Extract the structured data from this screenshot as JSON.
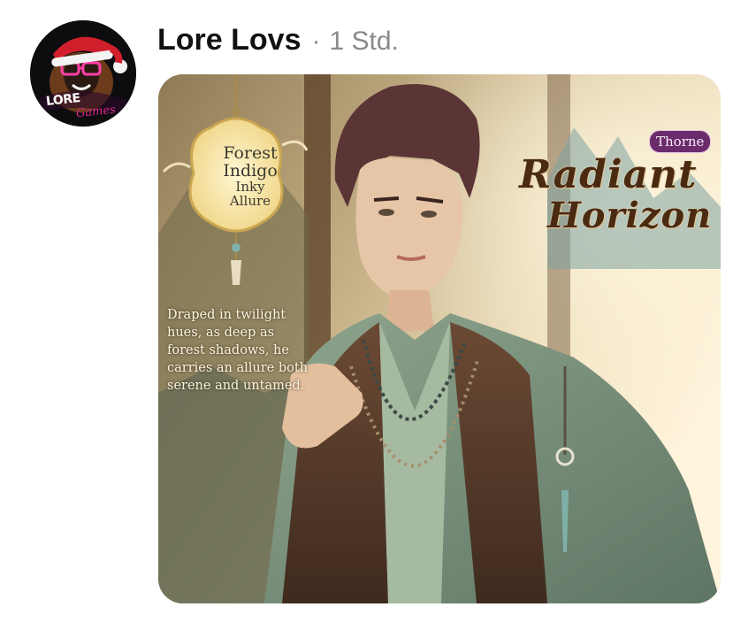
{
  "post": {
    "author": "Lore Lovs",
    "separator": "·",
    "time": "1 Std."
  },
  "avatar": {
    "label_main": "LORE",
    "label_sub": "Games"
  },
  "image": {
    "medallion": {
      "line1": "Forest",
      "line2": "Indigo",
      "line3": "Inky",
      "line4": "Allure"
    },
    "quote": "Draped in twilight hues, as deep as forest shadows, he carries an allure both serene and untamed.",
    "name_badge": "Thorne",
    "title_line1": "Radiant",
    "title_line2": "Horizon"
  },
  "colors": {
    "author_text": "#111111",
    "meta_text": "#8a8a8e",
    "badge_bg": "#6a2c6b",
    "title_text": "#4a2b12"
  }
}
